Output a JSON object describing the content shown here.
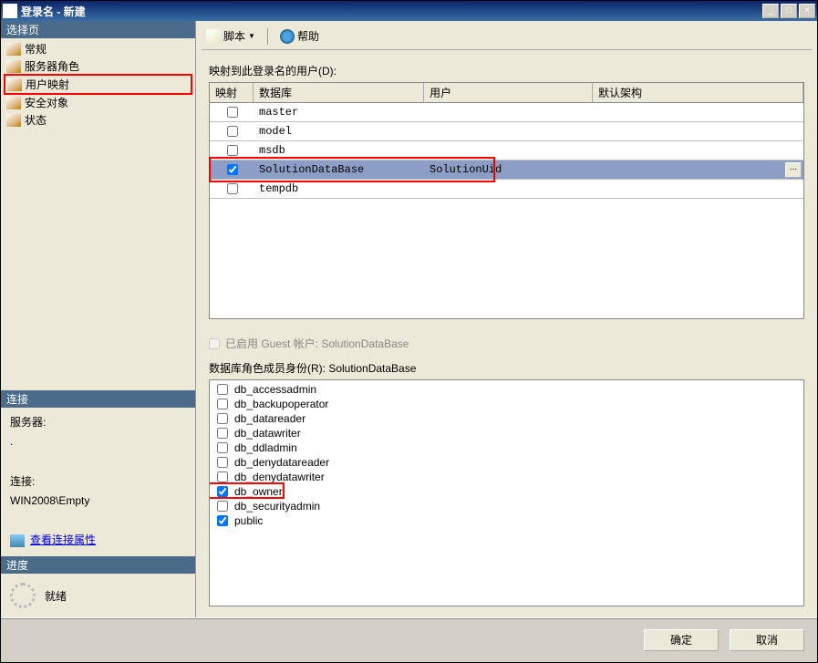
{
  "window": {
    "title": "登录名 - 新建"
  },
  "sidebar": {
    "select_page": "选择页",
    "items": [
      {
        "label": "常规"
      },
      {
        "label": "服务器角色"
      },
      {
        "label": "用户映射"
      },
      {
        "label": "安全对象"
      },
      {
        "label": "状态"
      }
    ],
    "connection_hdr": "连接",
    "server_label": "服务器:",
    "server_value": ".",
    "conn_label": "连接:",
    "conn_value": "WIN2008\\Empty",
    "view_conn_props": "查看连接属性",
    "progress_hdr": "进度",
    "progress_status": "就绪"
  },
  "toolbar": {
    "script": "脚本",
    "help": "帮助"
  },
  "main": {
    "mapping_label": "映射到此登录名的用户(D):",
    "columns": {
      "map": "映射",
      "db": "数据库",
      "user": "用户",
      "schema": "默认架构"
    },
    "rows": [
      {
        "checked": false,
        "db": "master",
        "user": "",
        "selected": false
      },
      {
        "checked": false,
        "db": "model",
        "user": "",
        "selected": false
      },
      {
        "checked": false,
        "db": "msdb",
        "user": "",
        "selected": false
      },
      {
        "checked": true,
        "db": "SolutionDataBase",
        "user": "SolutionUid",
        "selected": true
      },
      {
        "checked": false,
        "db": "tempdb",
        "user": "",
        "selected": false
      }
    ],
    "guest_prefix": "已启用 Guest 帐户: ",
    "selected_db": "SolutionDataBase",
    "roles_label": "数据库角色成员身份(R): ",
    "roles": [
      {
        "name": "db_accessadmin",
        "checked": false
      },
      {
        "name": "db_backupoperator",
        "checked": false
      },
      {
        "name": "db_datareader",
        "checked": false
      },
      {
        "name": "db_datawriter",
        "checked": false
      },
      {
        "name": "db_ddladmin",
        "checked": false
      },
      {
        "name": "db_denydatareader",
        "checked": false
      },
      {
        "name": "db_denydatawriter",
        "checked": false
      },
      {
        "name": "db_owner",
        "checked": true,
        "highlight": true
      },
      {
        "name": "db_securityadmin",
        "checked": false
      },
      {
        "name": "public",
        "checked": true
      }
    ]
  },
  "footer": {
    "ok": "确定",
    "cancel": "取消"
  }
}
